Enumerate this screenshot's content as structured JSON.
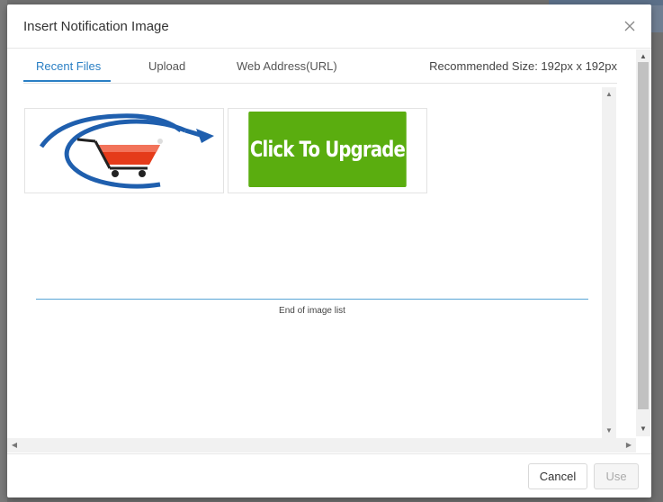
{
  "dialog": {
    "title": "Insert Notification Image"
  },
  "tabs": [
    {
      "label": "Recent Files",
      "active": true
    },
    {
      "label": "Upload",
      "active": false
    },
    {
      "label": "Web Address(URL)",
      "active": false
    }
  ],
  "recommended_size": "Recommended Size: 192px x 192px",
  "images": [
    {
      "icon": "shopping-cart-refresh-icon"
    },
    {
      "text": "Click To Upgrade"
    }
  ],
  "list_end_text": "End of image list",
  "footer": {
    "cancel_label": "Cancel",
    "use_label": "Use"
  },
  "colors": {
    "accent": "#2a7fc4",
    "upgrade_green": "#5aad0f",
    "cart_red": "#e53b1a",
    "arrow_blue": "#1f5fae"
  }
}
